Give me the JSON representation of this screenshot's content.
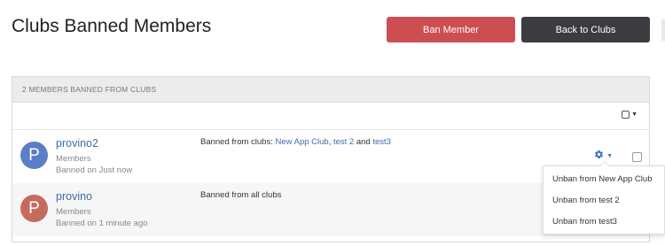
{
  "header": {
    "title": "Clubs Banned Members",
    "ban_member_label": "Ban Member",
    "back_label": "Back to Clubs"
  },
  "panel": {
    "header_text": "2 MEMBERS BANNED FROM CLUBS"
  },
  "rows": [
    {
      "avatar_letter": "P",
      "name": "provino2",
      "group": "Members",
      "banned_on": "Banned on Just now",
      "ban_prefix": "Banned from clubs: ",
      "clubs": [
        "New App Club",
        "test 2",
        "test3"
      ],
      "sep": ", ",
      "and": " and "
    },
    {
      "avatar_letter": "P",
      "name": "provino",
      "group": "Members",
      "banned_on": "Banned on 1 minute ago",
      "ban_text": "Banned from all clubs"
    }
  ],
  "dropdown": {
    "items": [
      "Unban from New App Club",
      "Unban from test 2",
      "Unban from test3"
    ]
  },
  "colors": {
    "ban_button": "#cd4e51",
    "back_button": "#3a3c40",
    "link": "#3a6ea5",
    "avatar_1": "#5b7ec6",
    "avatar_2": "#c66a5e"
  }
}
